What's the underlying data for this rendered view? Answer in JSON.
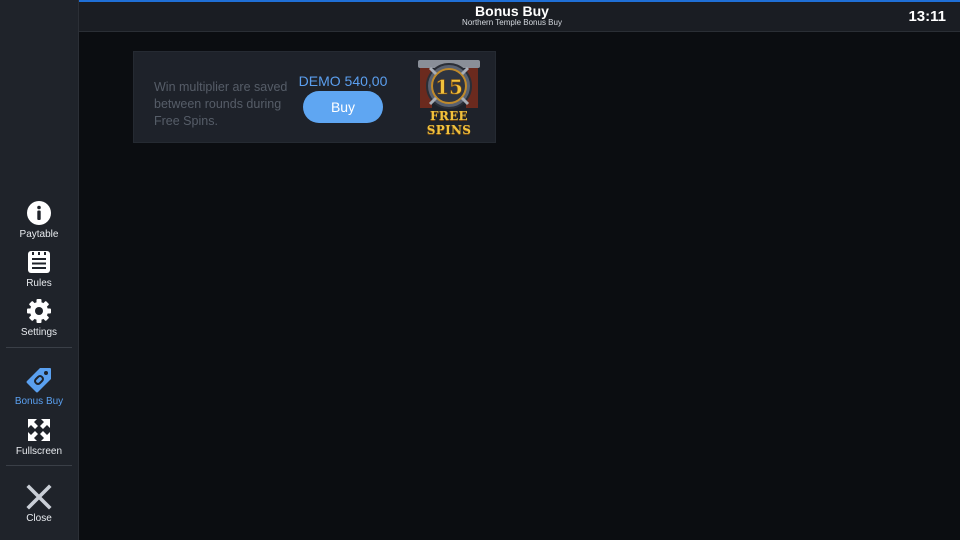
{
  "header": {
    "title": "Bonus Buy",
    "subtitle": "Northern Temple Bonus Buy",
    "clock": "13:11"
  },
  "sidebar": {
    "items": [
      {
        "label": "Paytable",
        "icon": "info-icon"
      },
      {
        "label": "Rules",
        "icon": "list-icon"
      },
      {
        "label": "Settings",
        "icon": "gear-icon"
      },
      {
        "label": "Bonus Buy",
        "icon": "tag-icon",
        "active": true
      },
      {
        "label": "Fullscreen",
        "icon": "fullscreen-icon"
      },
      {
        "label": "Close",
        "icon": "close-icon"
      }
    ]
  },
  "bonus_card": {
    "description": "Win multiplier are saved between rounds during Free Spins.",
    "price": "DEMO 540,00",
    "buy_label": "Buy",
    "badge_number": "15",
    "badge_text": "FREE SPINS"
  },
  "colors": {
    "accent": "#5fa6f2",
    "background": "#0b0d11",
    "sidebar": "#1f232a",
    "badge_gold": "#f2c23c"
  }
}
